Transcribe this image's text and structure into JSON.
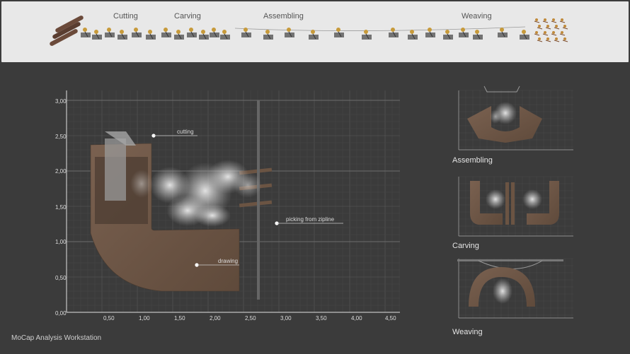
{
  "timeline": {
    "stages": [
      {
        "label": "Cutting",
        "x": 173
      },
      {
        "label": "Carving",
        "x": 262
      },
      {
        "label": "Assembling",
        "x": 395
      },
      {
        "label": "Weaving",
        "x": 670
      }
    ]
  },
  "main_plot": {
    "x_ticks": [
      "0,50",
      "1,00",
      "1,50",
      "2,00",
      "2,50",
      "3,00",
      "3,50",
      "4,00",
      "4,50"
    ],
    "y_ticks": [
      "3,00",
      "2,50",
      "2,00",
      "1,50",
      "1,00",
      "0,50",
      "0,00"
    ],
    "annotations": [
      {
        "label": "cutting"
      },
      {
        "label": "picking from zipline"
      },
      {
        "label": "drawing"
      }
    ]
  },
  "side_views": [
    {
      "caption": "Assembling"
    },
    {
      "caption": "Carving"
    },
    {
      "caption": "Weaving"
    }
  ],
  "footer": {
    "title": "MoCap Analysis Workstation"
  },
  "colors": {
    "wood": "#6e5846",
    "background": "#3b3b3b",
    "strip": "#e8e8e8"
  }
}
